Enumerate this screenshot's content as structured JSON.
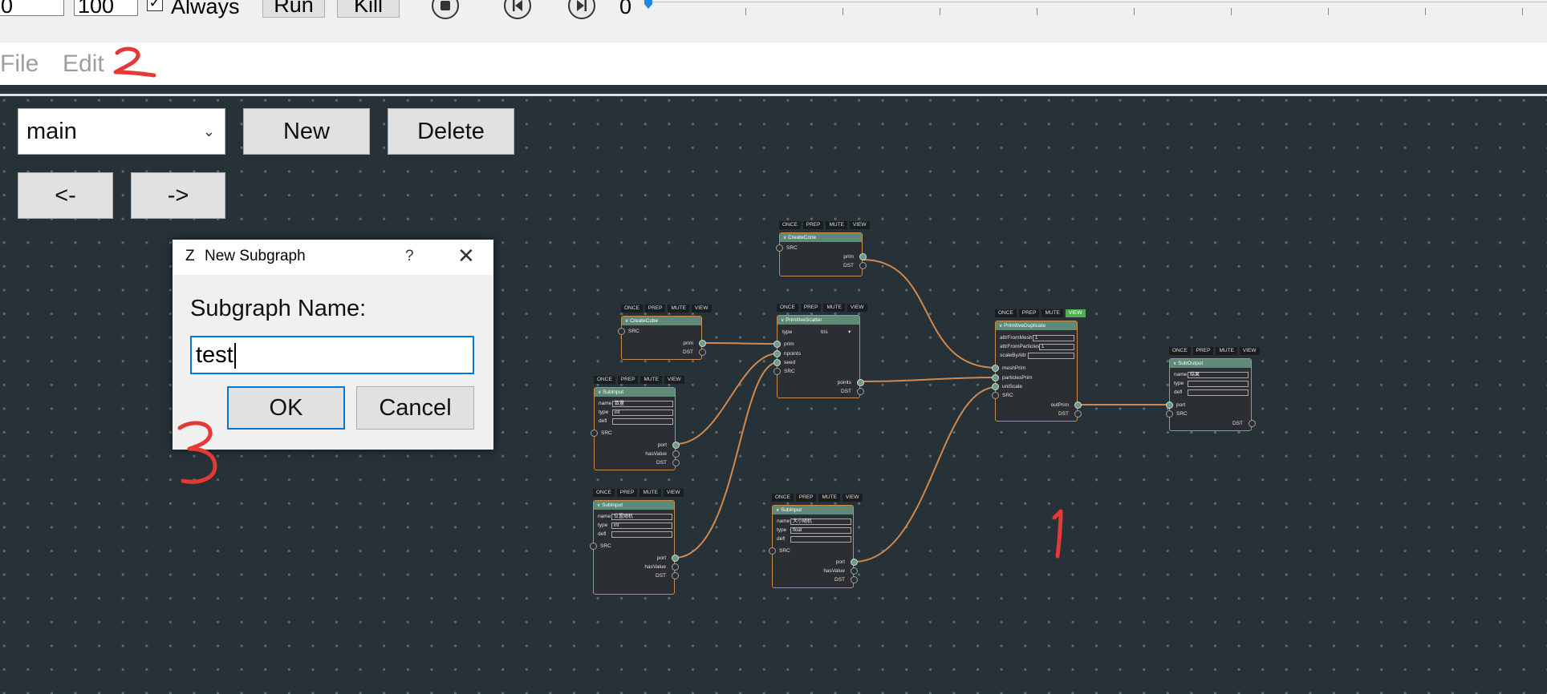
{
  "toolbar": {
    "start_frame": "0",
    "end_frame": "100",
    "always_checkbox": {
      "checked": true,
      "label": "Always"
    },
    "run_label": "Run",
    "kill_label": "Kill",
    "current_frame": "0",
    "icons": [
      "stop-icon",
      "skip-back-icon",
      "skip-forward-icon"
    ]
  },
  "menubar": {
    "items": [
      "File",
      "Edit"
    ]
  },
  "graph_controls": {
    "selected_graph": "main",
    "new_label": "New",
    "delete_label": "Delete",
    "back_label": "<-",
    "forward_label": "->"
  },
  "dialog": {
    "app_icon": "Z",
    "title": "New Subgraph",
    "help": "?",
    "close": "✕",
    "prompt": "Subgraph Name:",
    "value": "test",
    "ok_label": "OK",
    "cancel_label": "Cancel"
  },
  "node_header_buttons": [
    "ONCE",
    "PREP",
    "MUTE",
    "VIEW"
  ],
  "nodes": {
    "create_cone": {
      "title": "CreateCone",
      "inputs": [
        "SRC"
      ],
      "outputs": [
        "prim",
        "DST"
      ]
    },
    "create_cube": {
      "title": "CreateCube",
      "inputs": [
        "SRC"
      ],
      "outputs": [
        "prim",
        "DST"
      ]
    },
    "primitive_scatter": {
      "title": "PrimitiveScatter",
      "type_label": "type",
      "type_value": "tris",
      "inputs": [
        "prim",
        "npoints",
        "seed",
        "SRC"
      ],
      "outputs": [
        "points",
        "DST"
      ]
    },
    "primitive_duplicate": {
      "title": "PrimitiveDuplicate",
      "params": [
        {
          "name": "attrFromMesh",
          "value": "1"
        },
        {
          "name": "attrFromParticles",
          "value": "1"
        },
        {
          "name": "scaleByAttr",
          "value": ""
        }
      ],
      "inputs": [
        "meshPrim",
        "particlesPrim",
        "uniScale",
        "SRC"
      ],
      "outputs": [
        "outPrim",
        "DST"
      ]
    },
    "subinput_1": {
      "title": "SubInput",
      "params": [
        {
          "name": "name",
          "value": "数量"
        },
        {
          "name": "type",
          "value": "int"
        },
        {
          "name": "defl",
          "value": ""
        }
      ],
      "inputs": [
        "SRC"
      ],
      "outputs": [
        "port",
        "hasValue",
        "DST"
      ]
    },
    "subinput_2": {
      "title": "SubInput",
      "params": [
        {
          "name": "name",
          "value": "位置随机"
        },
        {
          "name": "type",
          "value": "int"
        },
        {
          "name": "defl",
          "value": ""
        }
      ],
      "inputs": [
        "SRC"
      ],
      "outputs": [
        "port",
        "hasValue",
        "DST"
      ]
    },
    "subinput_3": {
      "title": "SubInput",
      "params": [
        {
          "name": "name",
          "value": "大小随机"
        },
        {
          "name": "type",
          "value": "float"
        },
        {
          "name": "defl",
          "value": ""
        }
      ],
      "inputs": [
        "SRC"
      ],
      "outputs": [
        "port",
        "hasValue",
        "DST"
      ]
    },
    "suboutput": {
      "title": "SubOutput",
      "params": [
        {
          "name": "name",
          "value": "结果"
        },
        {
          "name": "type",
          "value": ""
        },
        {
          "name": "defl",
          "value": ""
        }
      ],
      "inputs": [
        "port",
        "SRC"
      ],
      "outputs": [
        "DST"
      ]
    }
  },
  "annotations": [
    "1",
    "2",
    "3"
  ],
  "colors": {
    "canvas": "#263238",
    "edge": "#d4874a",
    "node_title": "#5f8a77",
    "view_active": "#4caf50",
    "annotation": "#e53935",
    "focus": "#0078d7"
  }
}
